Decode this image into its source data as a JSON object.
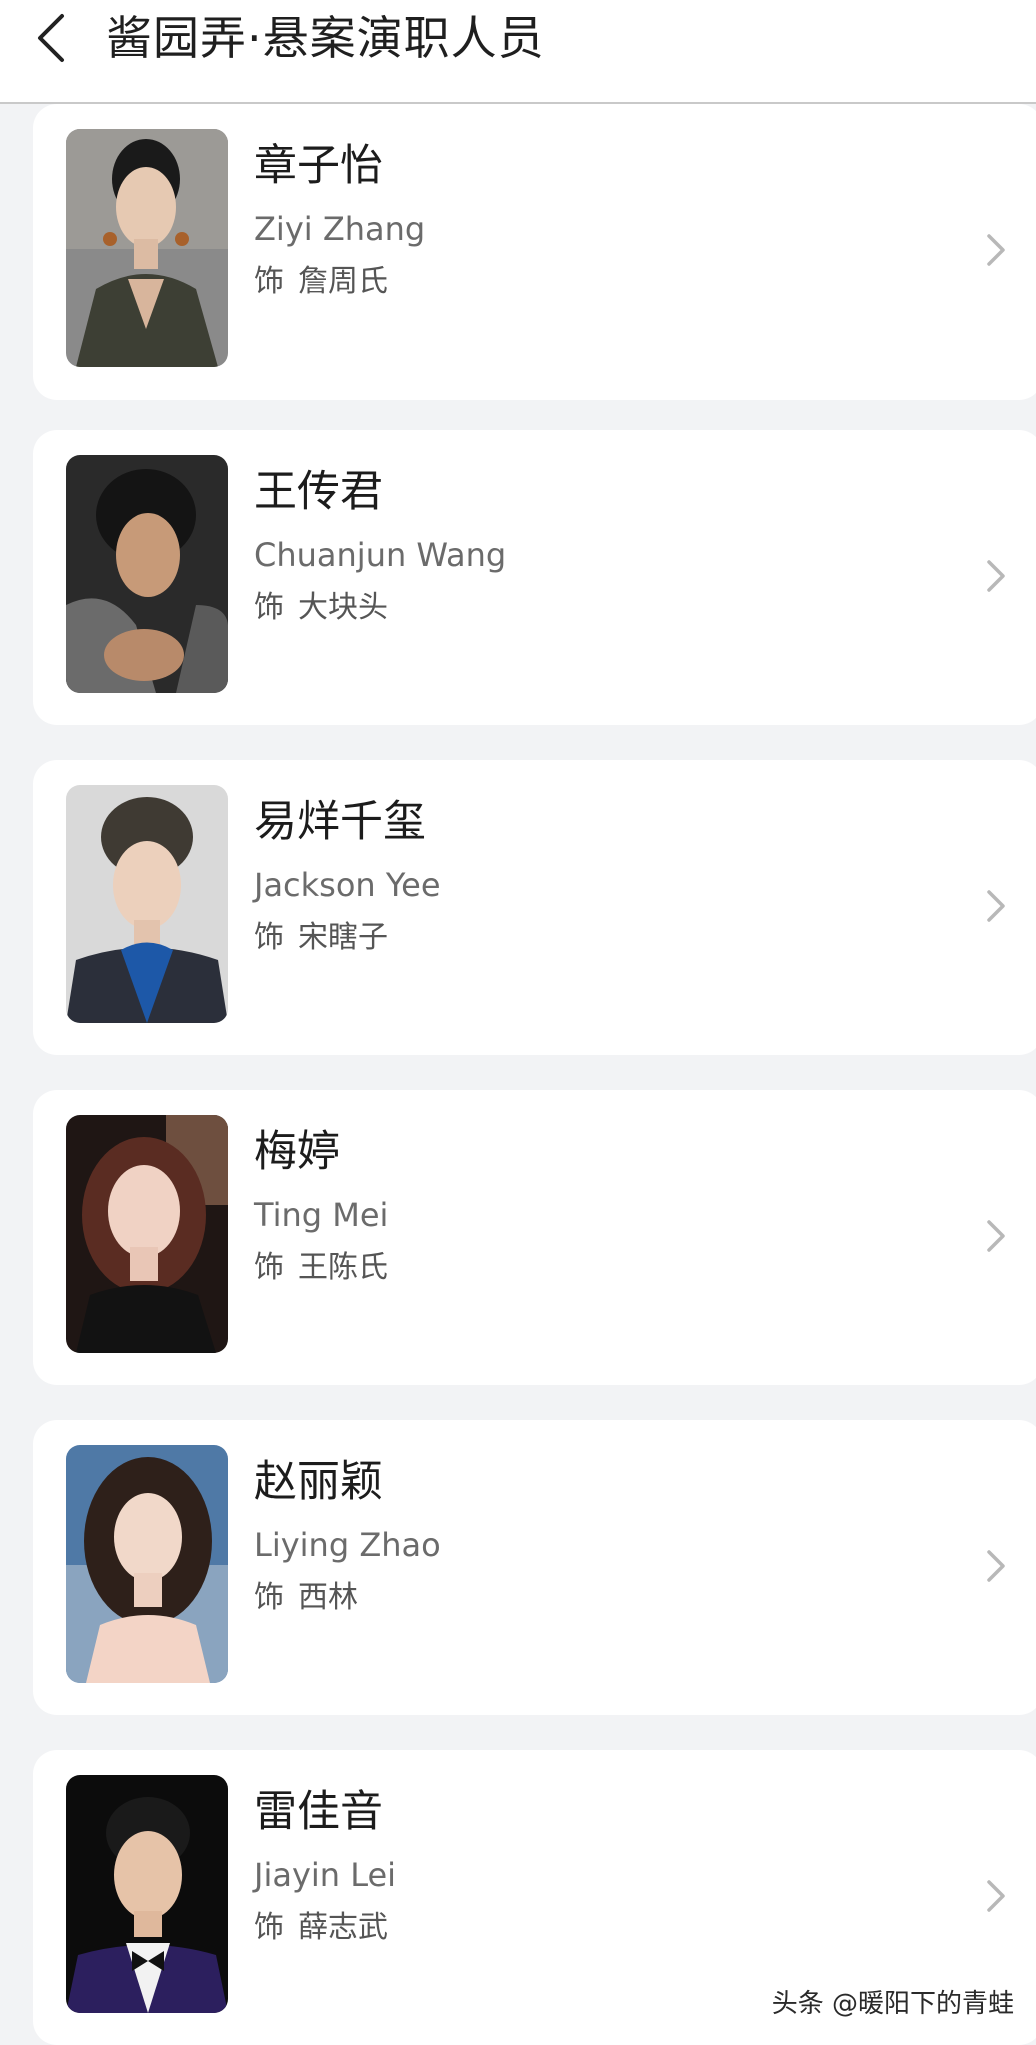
{
  "header": {
    "title": "酱园弄·悬案演职人员"
  },
  "cast": [
    {
      "name": "章子怡",
      "english": "Ziyi Zhang",
      "role_prefix": "饰",
      "role": "詹周氏"
    },
    {
      "name": "王传君",
      "english": "Chuanjun Wang",
      "role_prefix": "饰",
      "role": "大块头"
    },
    {
      "name": "易烊千玺",
      "english": "Jackson Yee",
      "role_prefix": "饰",
      "role": "宋瞎子"
    },
    {
      "name": "梅婷",
      "english": "Ting Mei",
      "role_prefix": "饰",
      "role": "王陈氏"
    },
    {
      "name": "赵丽颖",
      "english": "Liying Zhao",
      "role_prefix": "饰",
      "role": "西林"
    },
    {
      "name": "雷佳音",
      "english": "Jiayin Lei",
      "role_prefix": "饰",
      "role": "薛志武"
    }
  ],
  "watermark": "头条 @暖阳下的青蛙",
  "colors": {
    "background": "#f2f3f5",
    "card": "#ffffff",
    "name": "#1c1c1c",
    "secondary": "#6b6b6b",
    "chevron": "#b8b8b8"
  },
  "icons": {
    "back": "chevron-left-icon",
    "row_arrow": "chevron-right-icon"
  }
}
